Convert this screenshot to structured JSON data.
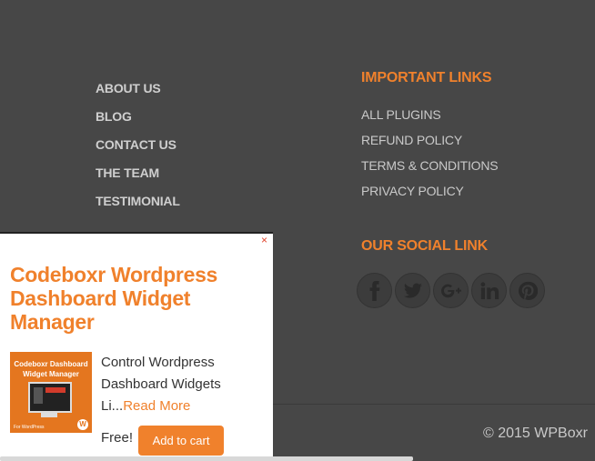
{
  "footer_nav": [
    "ABOUT US",
    "BLOG",
    "CONTACT US",
    "THE TEAM",
    "TESTIMONIAL"
  ],
  "important_links": {
    "title": "IMPORTANT LINKS",
    "items": [
      "ALL PLUGINS",
      "REFUND POLICY",
      "TERMS & CONDITIONS",
      "PRIVACY POLICY"
    ]
  },
  "social": {
    "title": "OUR SOCIAL LINK",
    "icons": [
      "facebook-icon",
      "twitter-icon",
      "google-plus-icon",
      "linkedin-icon",
      "pinterest-icon"
    ]
  },
  "copyright": "© 2015 WPBoxr",
  "popup": {
    "close": "×",
    "title": "Codeboxr Wordpress Dashboard Widget Manager",
    "image_title": "Codeboxr Dashboard Widget Manager",
    "image_footer": "For WordPress",
    "description": "Control Wordpress Dashboard Widgets Li...",
    "read_more": "Read More",
    "price": "Free!",
    "add_to_cart": "Add to cart"
  },
  "colors": {
    "accent": "#f0812c",
    "background": "#474747"
  }
}
